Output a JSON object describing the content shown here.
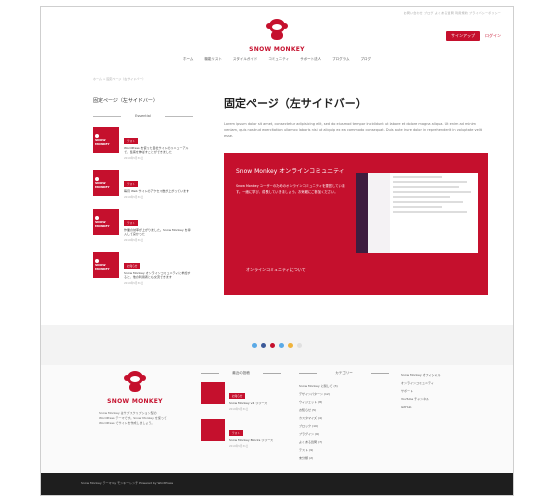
{
  "header": {
    "topnav": "お問い合わせ ブログ よくある質問 利用規約 プライバシーポリシー",
    "logo_text": "SNOW MONKEY",
    "signup": "サインアップ",
    "login": "ログイン"
  },
  "nav": {
    "items": [
      "ホーム",
      "機能リスト",
      "スタイルガイド",
      "コミュニティ",
      "サポート法人",
      "プログラム",
      "ブログ"
    ]
  },
  "breadcrumb": "ホーム > 固定ページ（左サイドバー）",
  "sidebar": {
    "title": "固定ページ（左サイドバー）",
    "category": "Essential",
    "thumb_text": "SNOW MONKEY",
    "posts": [
      {
        "badge": "テスト",
        "title": "WordPress を使った自社サイトのリニューアルで、集客を伸ばすことができました",
        "date": "2019年5月31日"
      },
      {
        "badge": "テスト",
        "title": "毎月 Web サイトのアクセス数が上がっています",
        "date": "2019年5月31日"
      },
      {
        "badge": "テスト",
        "title": "作業の効率が上がりました。Snow Monkey を導入して良かった",
        "date": "2019年5月31日"
      },
      {
        "badge": "お知らせ",
        "title": "Snow Monkey オンラインコミュニティに参加すると、他の利用者とも交流できます",
        "date": "2019年5月31日"
      }
    ]
  },
  "main": {
    "title": "固定ページ（左サイドバー）",
    "lorem": "Lorem ipsum dolor sit amet, consectetur adipisicing elit, sed do eiusmod tempor incididunt ut labore et dolore magna aliqua. Ut enim ad minim veniam, quis nostrud exercitation ullamco laboris nisi ut aliquip ex ea commodo consequat. Duis aute irure dolor in reprehenderit in voluptate velit esse.",
    "promo_title": "Snow Monkey オンラインコミュニティ",
    "promo_text": "Snow Monkey ユーザーのためのオンラインコミュニティを運営しています。一緒に学び、成長していきましょう。お気軽にご参加ください。",
    "promo_link": "オンラインコミュニティについて"
  },
  "social": {
    "icons": [
      {
        "name": "twitter-icon",
        "color": "#5aa9e6"
      },
      {
        "name": "facebook-icon",
        "color": "#3b5998"
      },
      {
        "name": "instagram-icon",
        "color": "#c5102d"
      },
      {
        "name": "youtube-icon",
        "color": "#5aa9e6"
      },
      {
        "name": "github-icon",
        "color": "#f0b43c"
      },
      {
        "name": "rss-icon",
        "color": "#e0e0e0"
      }
    ]
  },
  "footer": {
    "logo_text": "SNOW MONKEY",
    "about": "Snow Monkey はサブスクリプション型の WordPress テーマです。Snow Monkey を使って WordPress でサイトを作成しましょう。",
    "recent_heading": "最近の投稿",
    "recent_posts": [
      {
        "badge": "お知らせ",
        "title": "Snow Monkey v4 リリース",
        "date": "2019年5月31日"
      },
      {
        "badge": "テスト",
        "title": "Snow Monkey Blocks リリース",
        "date": "2019年5月31日"
      }
    ],
    "category_heading": "カテゴリー",
    "categories": [
      "Snow Monkey に関して (3)",
      "デザインパターン (12)",
      "ウィジェット (8)",
      "お知らせ (5)",
      "カスタマイズ (4)",
      "ブロック (10)",
      "プラグイン (6)",
      "よくある質問 (7)",
      "テスト (9)",
      "未分類 (2)"
    ],
    "links": [
      "Snow Monkey オフィシャル",
      "オンラインコミュニティ",
      "サポート",
      "YouTube チャンネル",
      "GitHub"
    ],
    "copyright": "Snow Monkey テーマ by モンキーレンチ Powered by WordPress"
  }
}
